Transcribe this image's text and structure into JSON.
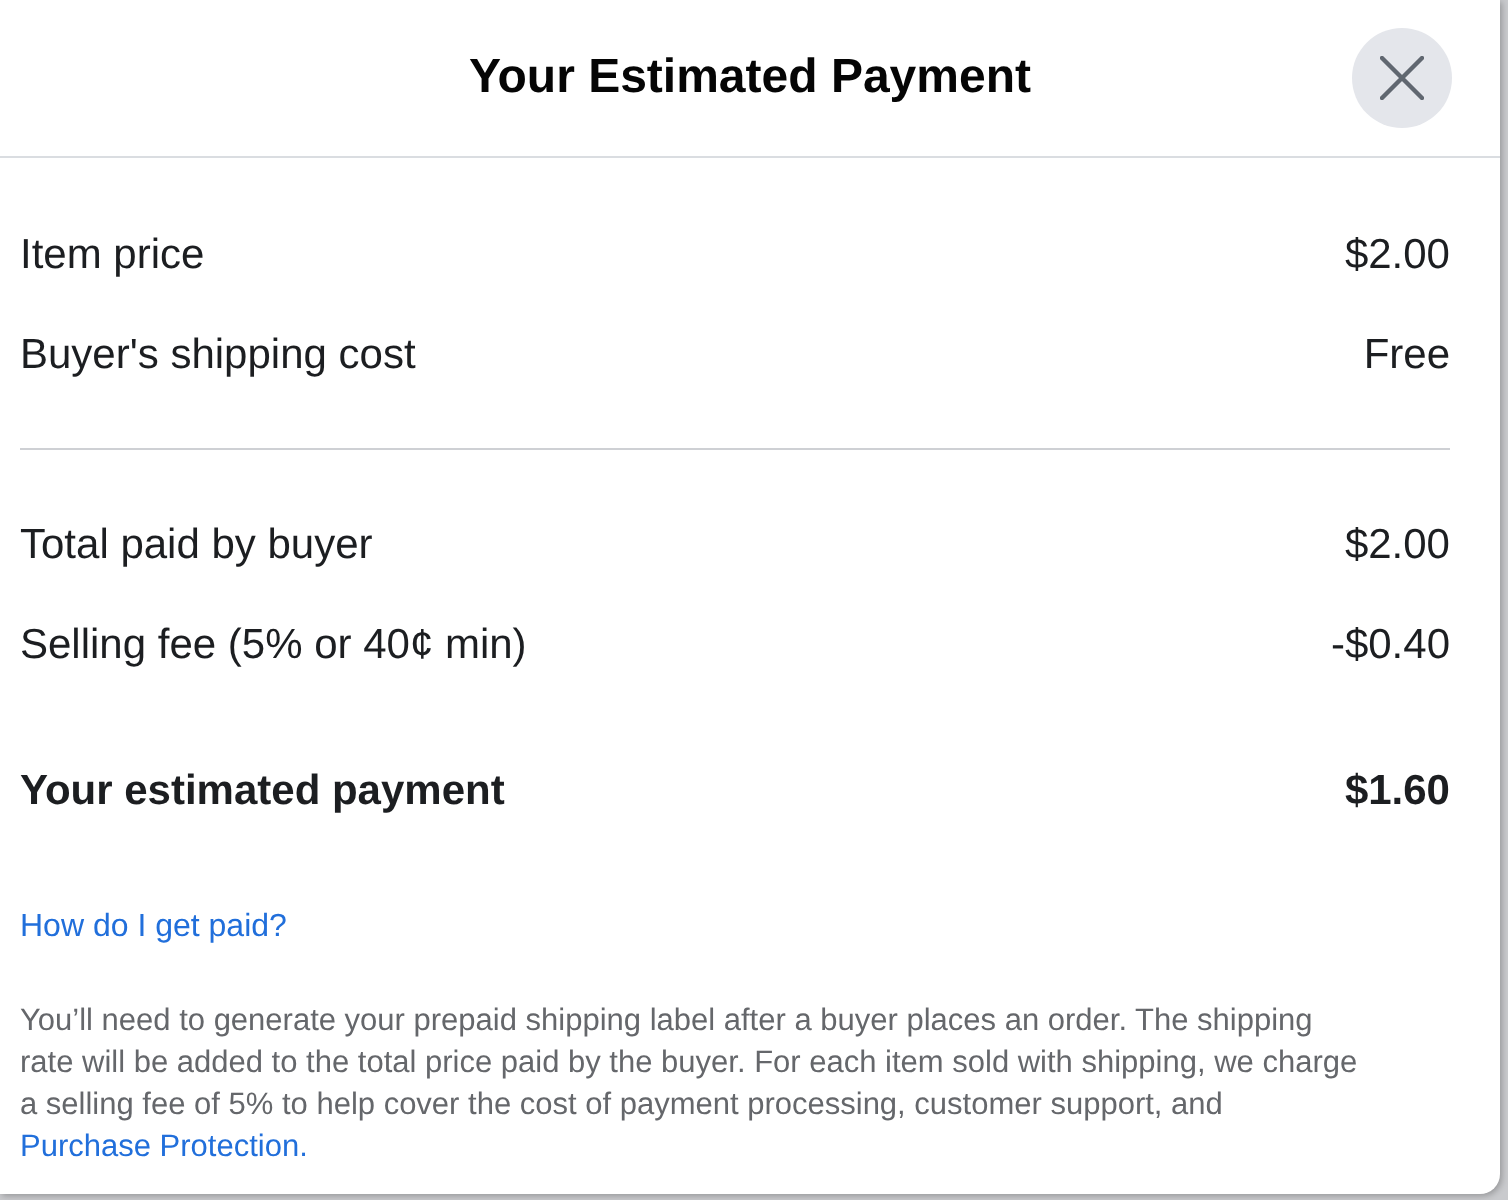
{
  "dialog": {
    "title": "Your Estimated Payment"
  },
  "sections": [
    {
      "rows": [
        {
          "label": "Item price",
          "value": "$2.00"
        },
        {
          "label": "Buyer's shipping cost",
          "value": "Free"
        }
      ]
    },
    {
      "rows": [
        {
          "label": "Total paid by buyer",
          "value": "$2.00"
        },
        {
          "label": "Selling fee (5% or 40¢ min)",
          "value": "-$0.40"
        }
      ]
    }
  ],
  "total": {
    "label": "Your estimated payment",
    "value": "$1.60"
  },
  "help_link": "How do I get paid?",
  "note": {
    "text": "You’ll need to generate your prepaid shipping label after a buyer places an order. The shipping rate will be added to the total price paid by the buyer. For each item sold with shipping, we charge a selling fee of 5% to help cover the cost of payment processing, customer support, and",
    "link": "Purchase Protection."
  }
}
